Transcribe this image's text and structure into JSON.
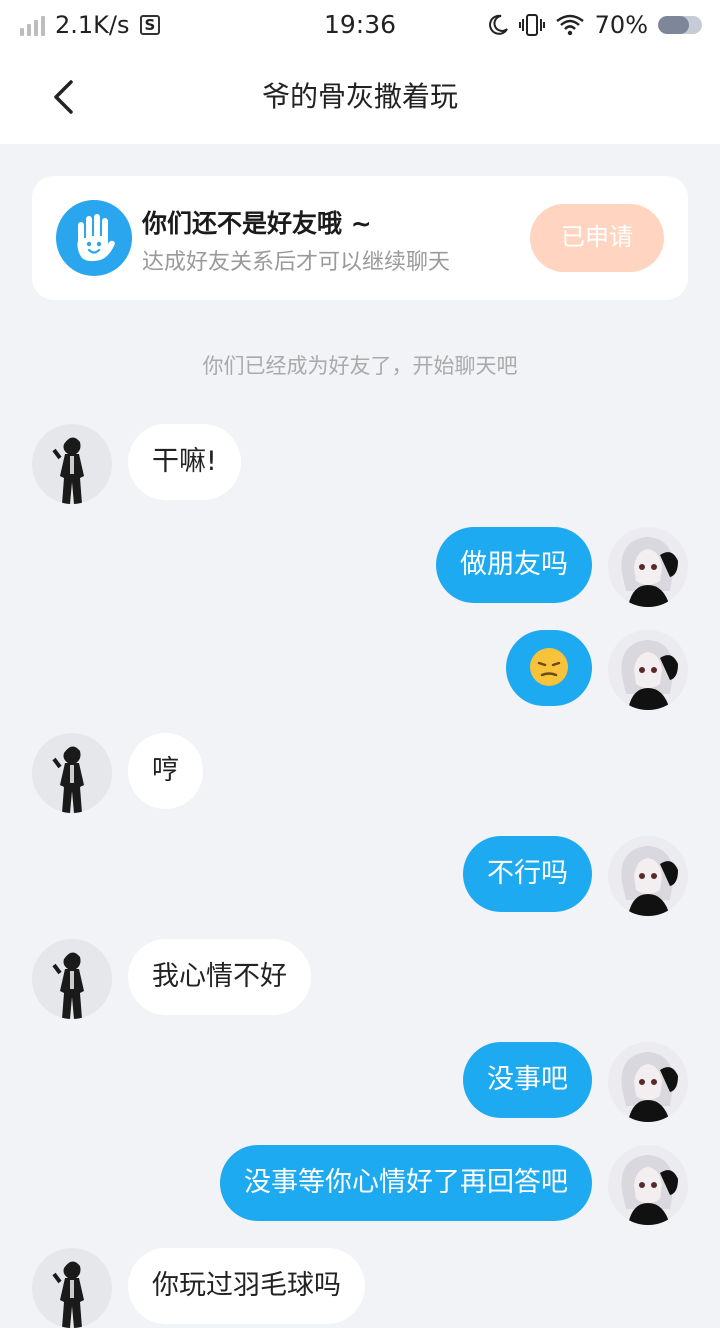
{
  "status_bar": {
    "net_speed": "2.1K/s",
    "badge": "S",
    "time": "19:36",
    "battery": "70%",
    "battery_level": 0.7
  },
  "header": {
    "title": "爷的骨灰撒着玩"
  },
  "friend_card": {
    "title": "你们还不是好友哦 ~",
    "subtitle": "达成好友关系后才可以继续聊天",
    "button": "已申请"
  },
  "system_note": "你们已经成为好友了，开始聊天吧",
  "messages": [
    {
      "side": "left",
      "text": "干嘛!"
    },
    {
      "side": "right",
      "text": "做朋友吗"
    },
    {
      "side": "right",
      "text": "",
      "emoji": "pensive-face"
    },
    {
      "side": "left",
      "text": "哼"
    },
    {
      "side": "right",
      "text": "不行吗"
    },
    {
      "side": "left",
      "text": "我心情不好"
    },
    {
      "side": "right",
      "text": "没事吧"
    },
    {
      "side": "right",
      "text": "没事等你心情好了再回答吧"
    },
    {
      "side": "left",
      "text": "你玩过羽毛球吗"
    }
  ],
  "colors": {
    "accent": "#1eaaf0",
    "background": "#f2f3f6",
    "applied_button": "#ffd4c0"
  }
}
